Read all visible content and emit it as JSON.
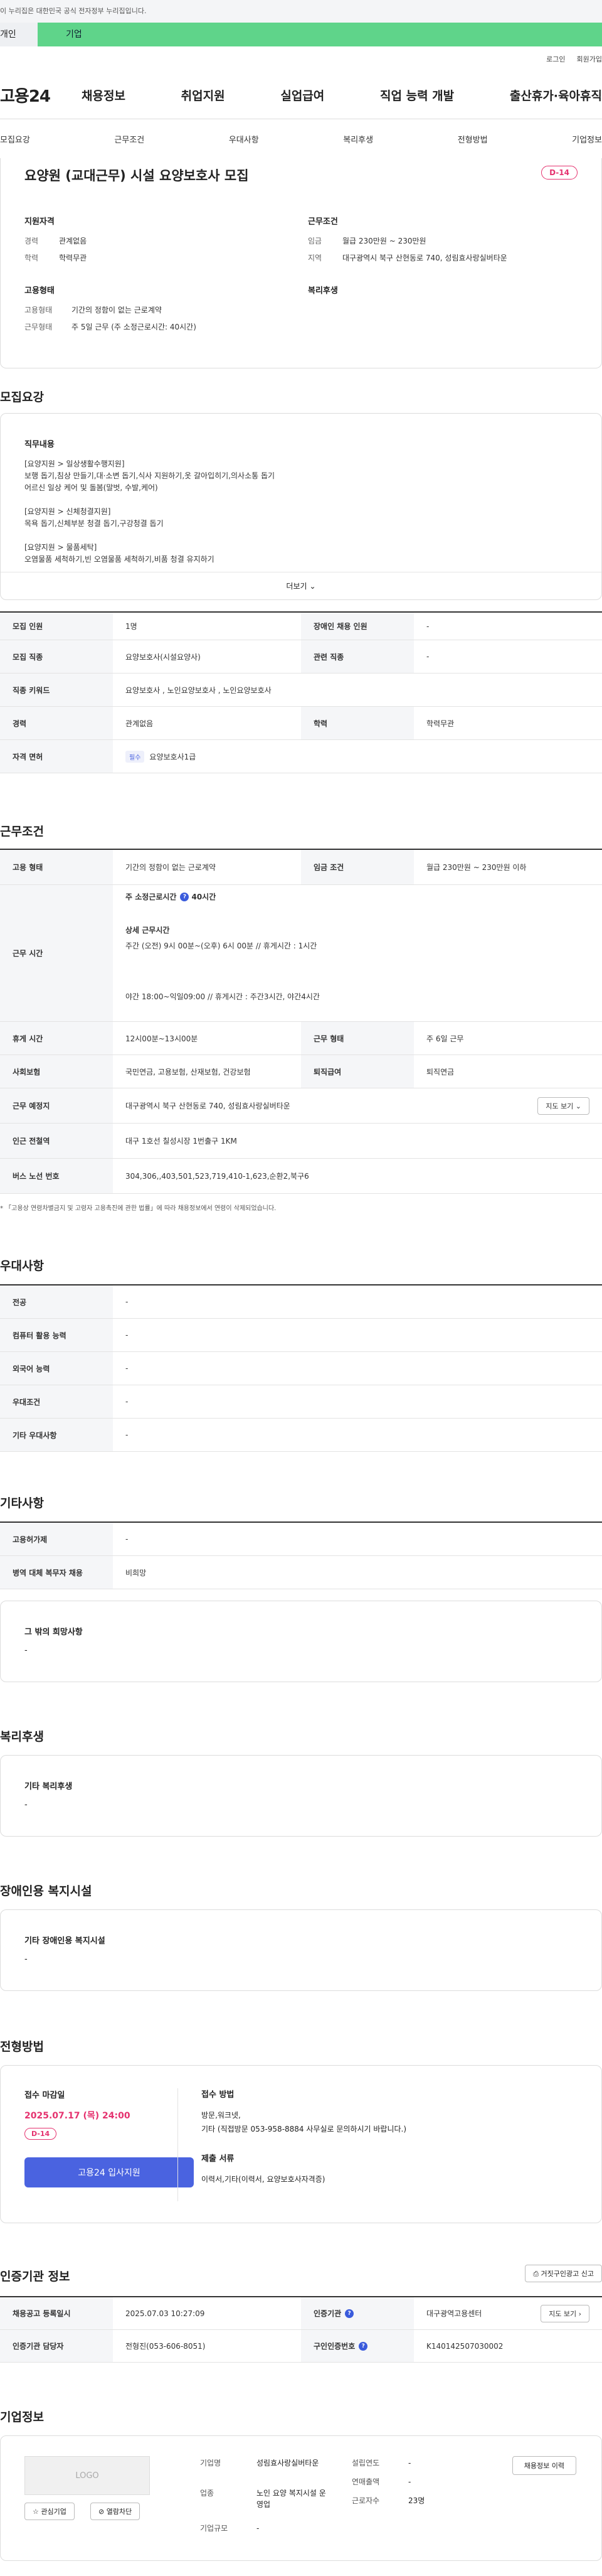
{
  "top_notice": "이 누리집은 대한민국 공식 전자정부 누리집입니다.",
  "gov_tabs": [
    "개인",
    "기업"
  ],
  "util": [
    "로그인",
    "회원가입"
  ],
  "logo": "고용24",
  "gnb": [
    "채용정보",
    "취업지원",
    "실업급여",
    "직업 능력 개발",
    "출산휴가·육아휴직"
  ],
  "anchors": [
    "모집요강",
    "근무조건",
    "우대사항",
    "복리후생",
    "전형방법",
    "기업정보"
  ],
  "job": {
    "title": "요양원 (교대근무) 시설 요양보호사 모집",
    "dday": "D-14",
    "qual_head": "지원자격",
    "qual": [
      {
        "k": "경력",
        "v": "관계없음"
      },
      {
        "k": "학력",
        "v": "학력무관"
      }
    ],
    "cond_head": "근무조건",
    "cond": [
      {
        "k": "임금",
        "v": "월급 230만원 ~ 230만원"
      },
      {
        "k": "지역",
        "v": "대구광역시 북구 산현동로 740, 성림효사랑실버타운"
      }
    ],
    "emp_head": "고용형태",
    "emp": [
      {
        "k": "고용형태",
        "v": "기간의 정함이 없는 근로계약"
      },
      {
        "k": "근무형태",
        "v": "주 5일 근무 (주 소정근로시간: 40시간)"
      }
    ],
    "welfare_head": "복리후생"
  },
  "recruit": {
    "title": "모집요강",
    "duty_head": "직무내용",
    "duty_lines": [
      "[요양지원 > 일상생활수행지원]",
      "보행 돕기,침상 만들기,대·소변 돕기,식사 지원하기,옷 갈아입히기,의사소통 돕기",
      "어르신 일상 케어 및 돌봄(말벗, 수발,케어)",
      "",
      "[요양지원 > 신체청결지원]",
      "목욕 돕기,신체부분 청결 돕기,구강청결 돕기",
      "",
      "[요양지원 > 물품세탁]",
      "오염물품 세척하기,빈 오염물품 세척하기,비품 청결 유지하기"
    ],
    "more": "더보기",
    "rows": [
      {
        "th": "모집 인원",
        "td": "1명",
        "th2": "장애인 채용 인원",
        "td2": "-"
      },
      {
        "th": "모집 직종",
        "td": "요양보호사(시설요양사)",
        "th2": "관련 직종",
        "td2": "-"
      },
      {
        "th": "직종 키워드",
        "td": "요양보호사 , 노인요양보호사 , 노인요양보호사"
      },
      {
        "th": "경력",
        "td": "관계없음",
        "th2": "학력",
        "td2": "학력무관"
      },
      {
        "th": "자격 면허",
        "tag": "필수",
        "td": "요양보호사1급"
      }
    ]
  },
  "conditions": {
    "title": "근무조건",
    "emp_th": "고용 형태",
    "emp_td": "기간의 정함이 없는 근로계약",
    "wage_th": "임금 조건",
    "wage_td": "월급 230만원 ~ 230만원 이하",
    "time_th": "근무 시간",
    "time_week": "주 소정근로시간",
    "time_hours": "40시간",
    "time_detail_head": "상세 근무시간",
    "time_line1": "주간 (오전) 9시 00분~(오후) 6시 00분  //  휴게시간 : 1시간",
    "time_line2": "야간 18:00~익일09:00  // 휴게시간 :  주간3시간, 야간4시간",
    "rest_th": "휴게 시간",
    "rest_td": "12시00분~13시00분",
    "form_th": "근무 형태",
    "form_td": "주 6일 근무",
    "ins_th": "사회보험",
    "ins_td": "국민연금, 고용보험, 산재보험, 건강보험",
    "retire_th": "퇴직급여",
    "retire_td": "퇴직연금",
    "place_th": "근무 예정지",
    "place_td": "대구광역시 북구 산현동로 740, 성림효사랑실버타운",
    "map_btn": "지도 보기",
    "subway_th": "인근 전철역",
    "subway_td": "대구 1호선 칠성시장 1번출구 1KM",
    "bus_th": "버스 노선 번호",
    "bus_td": "304,306,,403,501,523,719,410-1,623,순환2,북구6",
    "note": "* 「고용상 연령차별금지 및 고령자 고용촉진에 관한 법률」에 따라 채용정보에서 연령이 삭제되었습니다."
  },
  "prefer": {
    "title": "우대사항",
    "rows": [
      {
        "th": "전공",
        "td": "-"
      },
      {
        "th": "컴퓨터 활용 능력",
        "td": "-"
      },
      {
        "th": "외국어 능력",
        "td": "-"
      },
      {
        "th": "우대조건",
        "td": "-"
      },
      {
        "th": "기타 우대사항",
        "td": "-"
      }
    ]
  },
  "etc": {
    "title": "기타사항",
    "rows": [
      {
        "th": "고용허가제",
        "td": "-"
      },
      {
        "th": "병역 대체 복무자 채용",
        "td": "비희망"
      }
    ],
    "box_head": "그 밖의 희망사항",
    "box_val": "-"
  },
  "welfare": {
    "title": "복리후생",
    "box_head": "기타 복리후생",
    "box_val": "-"
  },
  "disabled": {
    "title": "장애인용 복지시설",
    "box_head": "기타 장애인용 복지시설",
    "box_val": "-"
  },
  "selection": {
    "title": "전형방법",
    "deadline_head": "접수 마감일",
    "deadline": "2025.07.17 (목) 24:00",
    "dday": "D-14",
    "apply": "고용24 입사지원",
    "method_head": "접수 방법",
    "method1": "방문,워크넷,",
    "method2": "기타 (직접방문 053-958-8884 사무실로 문의하시기 바랍니다.)",
    "docs_head": "제출 서류",
    "docs": "이력서,기타(이력서, 요양보호사자격증)"
  },
  "auth": {
    "title": "인증기관 정보",
    "report": "거짓구인광고 신고",
    "r1th": "채용공고 등록일시",
    "r1td": "2025.07.03 10:27:09",
    "r1th2": "인증기관",
    "r1td2": "대구광역고용센터",
    "map": "지도 보기",
    "r2th": "인증기관 담당자",
    "r2td": "전형진(053-606-8051)",
    "r2th2": "구인인증번호",
    "r2td2": "K140142507030002"
  },
  "company": {
    "title": "기업정보",
    "logo": "LOGO",
    "fav": "관심기업",
    "block": "열람차단",
    "view_jobs": "채용정보 이력",
    "k1": "기업명",
    "v1": "성림효사랑실버타운",
    "k2": "업종",
    "v2": "노인 요양 복지시설 운영업",
    "k3": "기업규모",
    "v3": "-",
    "k4": "설립연도",
    "v4": "-",
    "k5": "연매출액",
    "v5": "-",
    "k6": "근로자수",
    "v6": "23명"
  },
  "colors": {
    "accent": "#4a63e0",
    "dday": "#e5326f",
    "gov_green": "#5fd48a"
  }
}
